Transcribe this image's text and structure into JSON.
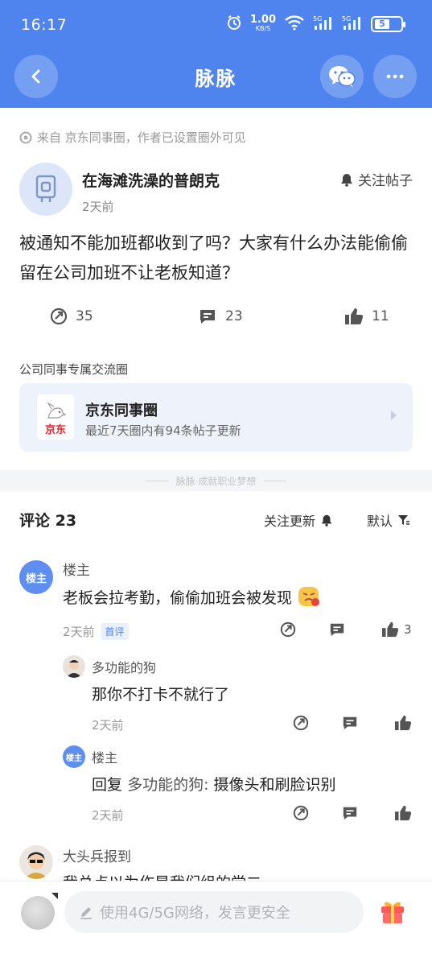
{
  "status_bar": {
    "time": "16:17",
    "speed_value": "1.00",
    "speed_unit": "KB/S",
    "battery": "5"
  },
  "nav": {
    "title": "脉脉"
  },
  "post": {
    "source": "来自 京东同事圈，作者已设置圈外可见",
    "author_name": "在海滩洗澡的普朗克",
    "time": "2天前",
    "follow_label": "关注帖子",
    "body": "被通知不能加班都收到了吗？大家有什么办法能偷偷留在公司加班不让老板知道？",
    "shares": "35",
    "comments": "23",
    "likes": "11"
  },
  "circle": {
    "section_label": "公司同事专属交流圈",
    "logo_text": "京东",
    "name": "京东同事圈",
    "subtitle": "最近7天圈内有94条帖子更新"
  },
  "divider_text": "脉脉·成就职业梦想",
  "comments_header": {
    "title": "评论 23",
    "follow_update": "关注更新",
    "sort": "默认"
  },
  "comments": [
    {
      "badge": "楼主",
      "name": "楼主",
      "text": "老板会拉考勤，偷偷加班会被发现",
      "time": "2天前",
      "tag": "首评",
      "likes": "3",
      "replies": [
        {
          "name": "多功能的狗",
          "text": "那你不打卡不就行了",
          "time": "2天前"
        },
        {
          "badge": "楼主",
          "name": "楼主",
          "reply_prefix": "回复",
          "reply_to": "多功能的狗:",
          "text": "摄像头和刷脸识别",
          "time": "2天前"
        }
      ]
    },
    {
      "name": "大头兵报到",
      "text": "我总点以为作是我们组的党二"
    }
  ],
  "bottom": {
    "placeholder": "使用4G/5G网络，发言更安全"
  },
  "colors": {
    "brand": "#4f84ee",
    "badge": "#5d8ef0"
  }
}
